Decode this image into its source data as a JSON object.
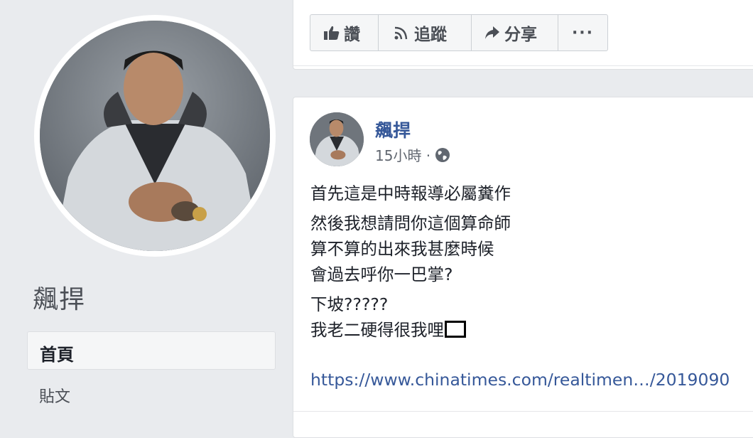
{
  "profile": {
    "name": "飆捍"
  },
  "nav": {
    "home_label": "首頁",
    "posts_label": "貼文"
  },
  "actions": {
    "like_label": "讚",
    "follow_label": "追蹤",
    "share_label": "分享",
    "more_label": "···",
    "like_icon": "thumbs-up-icon",
    "follow_icon": "rss-icon",
    "share_icon": "share-arrow-icon"
  },
  "post": {
    "author": "飆捍",
    "time": "15小時 · ",
    "privacy_icon": "globe-icon",
    "lines": [
      "首先這是中時報導必屬糞作",
      "然後我想請問你這個算命師",
      "算不算的出來我甚麼時候",
      "會過去呼你一巴掌?",
      "下坡?????",
      "我老二硬得很我哩"
    ],
    "link": "https://www.chinatimes.com/realtimen…/2019090"
  },
  "colors": {
    "background": "#e9ebee",
    "link": "#365899",
    "text": "#1d2129"
  }
}
